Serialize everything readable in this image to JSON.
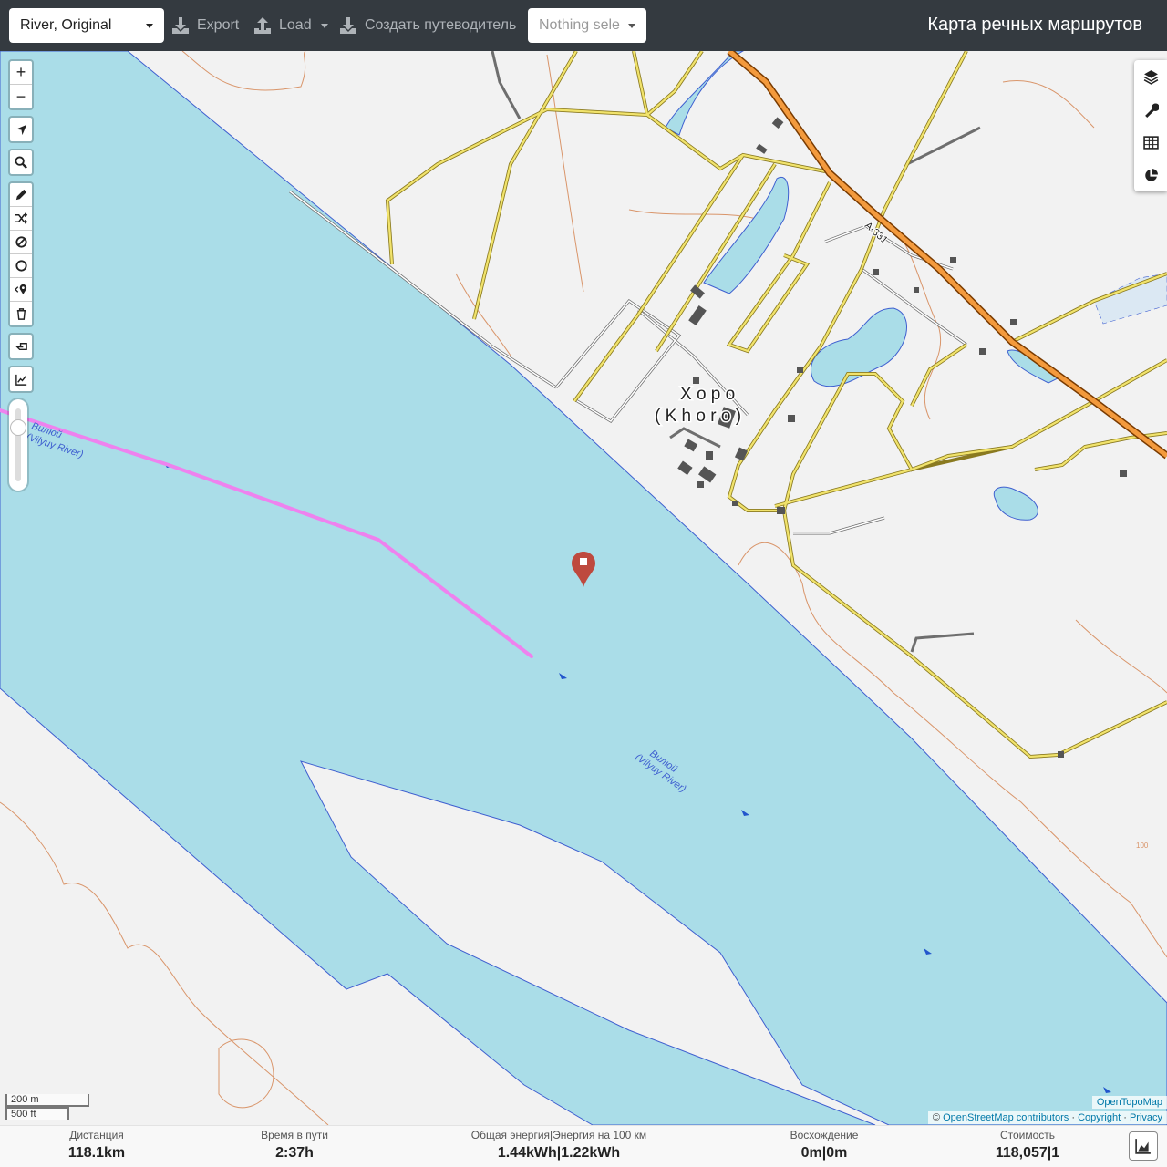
{
  "topbar": {
    "profile": "River, Original",
    "export_label": "Export",
    "load_label": "Load",
    "guide_label": "Создать путеводитель",
    "nothing_selected": "Nothing sele",
    "app_title": "Карта речных маршрутов"
  },
  "map": {
    "labels": {
      "town_ru": "Х о р о",
      "town_en": "( K h o r o )",
      "river_1a": "Вилюй",
      "river_1b": "(Vilyuy River)",
      "river_2a": "Вилюй",
      "river_2b": "(Vilyuy River)",
      "road_ref": "А-331",
      "contour_100": "100"
    },
    "scale_metric": "200 m",
    "scale_imperial": "500 ft",
    "attribution_topo": "OpenTopoMap",
    "attribution": {
      "prefix": "©",
      "osm": "OpenStreetMap contributors",
      "sep1": "·",
      "copyright": "Copyright",
      "sep2": "·",
      "privacy": "Privacy"
    },
    "colors": {
      "water": "#aadde8",
      "route": "#ee82ee",
      "marker": "#c0392b",
      "major_road": "#f39a3d",
      "minor_road": "#e6d25a"
    }
  },
  "controls": {
    "zoom_in": "+",
    "zoom_out": "−",
    "zoom_level": 0.84
  },
  "stats": {
    "distance": {
      "label": "Дистанция",
      "value": "118.1",
      "unit": "km"
    },
    "time": {
      "label": "Время в пути",
      "value": "2:37",
      "unit": "h"
    },
    "energy": {
      "label": "Общая энергия|Энергия на 100 км",
      "value1": "1.44",
      "unit1": "kWh",
      "sep": "|",
      "value2": "1.22",
      "unit2": "kWh"
    },
    "ascent": {
      "label": "Восхождение",
      "value1": "0",
      "unit1": "m",
      "sep": "|",
      "value2": "0",
      "unit2": "m"
    },
    "cost": {
      "label": "Стоимость",
      "value1": "118,057",
      "sep": "|",
      "value2": "1"
    }
  }
}
